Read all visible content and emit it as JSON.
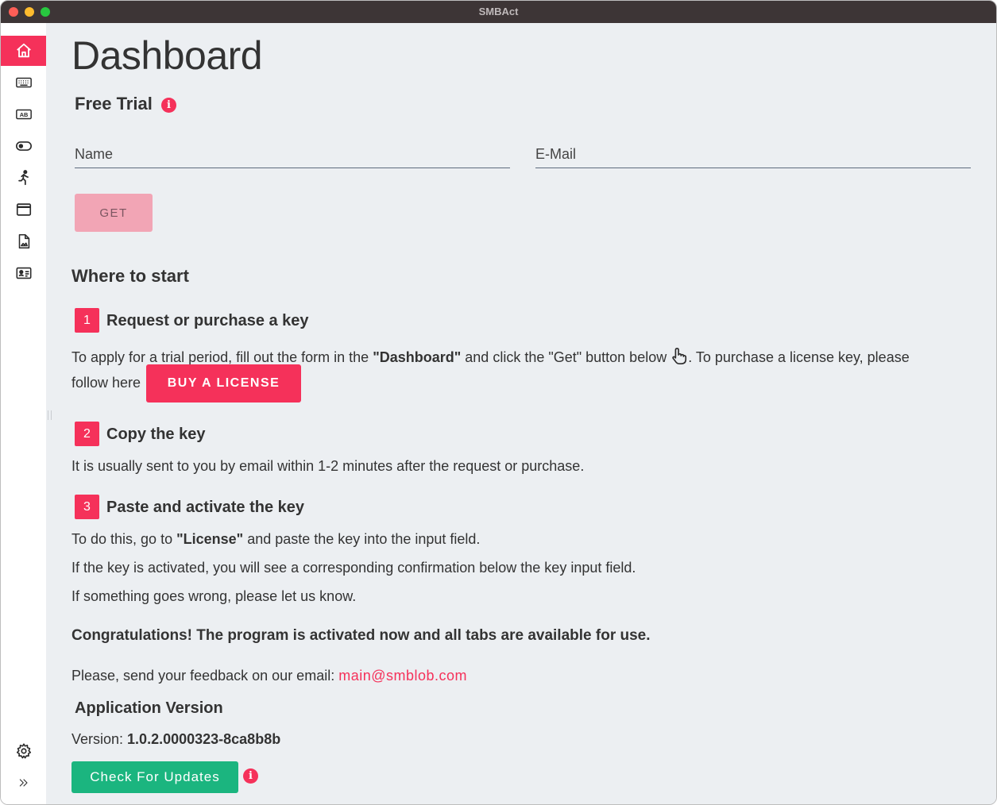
{
  "window": {
    "title": "SMBAct"
  },
  "sidebar": {
    "items": [
      {
        "icon": "home-icon",
        "active": true
      },
      {
        "icon": "keyboard-icon",
        "active": false
      },
      {
        "icon": "ab-text-icon",
        "active": false
      },
      {
        "icon": "toggle-icon",
        "active": false
      },
      {
        "icon": "running-person-icon",
        "active": false
      },
      {
        "icon": "browser-window-icon",
        "active": false
      },
      {
        "icon": "document-image-icon",
        "active": false
      },
      {
        "icon": "contact-card-icon",
        "active": false
      }
    ],
    "bottom": [
      {
        "icon": "gear-icon"
      },
      {
        "icon": "double-chevron-right-icon"
      }
    ]
  },
  "dashboard": {
    "title": "Dashboard",
    "free_trial": {
      "heading": "Free Trial",
      "name_placeholder": "Name",
      "email_placeholder": "E-Mail",
      "get_label": "GET"
    },
    "where_to_start": {
      "heading": "Where to start",
      "steps": [
        {
          "num": "1",
          "title": "Request or purchase a key",
          "line1_a": "To apply for a trial period, fill out the form in the ",
          "line1_b": "\"Dashboard\"",
          "line1_c": " and click the \"Get\" button below ",
          "line1_d": ". To purchase a license key, please",
          "line2": "follow here",
          "buy_label": "BUY A LICENSE"
        },
        {
          "num": "2",
          "title": "Copy the key",
          "text": "It is usually sent to you by email within 1-2 minutes after the request or purchase."
        },
        {
          "num": "3",
          "title": "Paste and activate the key",
          "line1_a": "To do this, go to ",
          "line1_b": "\"License\"",
          "line1_c": " and paste the key into the input field.",
          "line2": "If the key is activated, you will see a corresponding confirmation below the key input field.",
          "line3": "If something goes wrong, please let us know."
        }
      ],
      "congrats": "Congratulations! The program is activated now and all tabs are available for use.",
      "feedback_prefix": "Please, send your feedback on our email: ",
      "feedback_email": "main@smblob.com"
    },
    "app_version": {
      "heading": "Application Version",
      "label": "Version: ",
      "value": "1.0.2.0000323-8ca8b8b",
      "check_label": "Check For Updates"
    }
  },
  "colors": {
    "accent": "#f5315a",
    "accent_disabled": "#f2a5b5",
    "success": "#1bb57f",
    "background": "#eceff2",
    "titlebar": "#3d3536"
  }
}
